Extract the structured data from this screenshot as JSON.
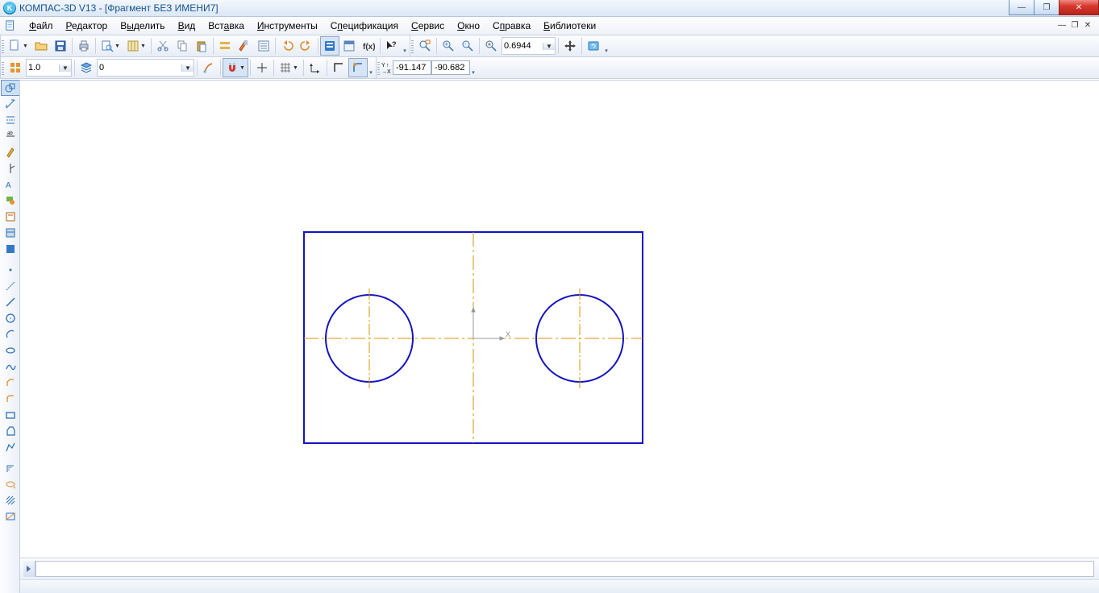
{
  "title": "КОМПАС-3D V13 - [Фрагмент БЕЗ ИМЕНИ7]",
  "app_icon_letter": "K",
  "menu": {
    "file": "Файл",
    "editor": "Редактор",
    "select": "Выделить",
    "view": "Вид",
    "insert": "Вставка",
    "tools": "Инструменты",
    "spec": "Спецификация",
    "service": "Сервис",
    "window": "Окно",
    "help": "Справка",
    "libs": "Библиотеки"
  },
  "zoom_value": "0.6944",
  "linewidth_value": "1.0",
  "layer_value": "0",
  "coord_x": "-91.147",
  "coord_y": "-90.682",
  "win_min": "—",
  "win_max": "❐",
  "win_close": "✕",
  "mdi_min": "—",
  "mdi_max": "❐",
  "mdi_close": "✕",
  "axis_x": "X",
  "axis_y_marker": "↑",
  "coord_lbl_x": "Y↑",
  "coord_lbl_y": "→X",
  "icons": {
    "shield": "shield",
    "magnet": "magnet"
  }
}
